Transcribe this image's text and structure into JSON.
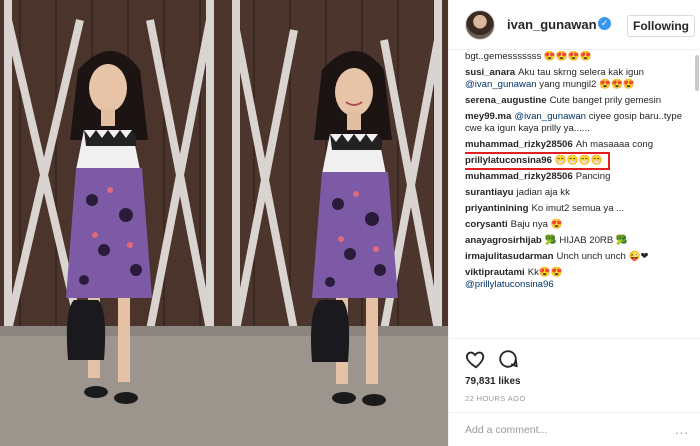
{
  "header": {
    "username": "ivan_gunawan",
    "verified_icon": "verified-badge-icon",
    "follow_label": "Following"
  },
  "comments": [
    {
      "user": "",
      "text": "bgt..gemesssssss 😍😍😍😍"
    },
    {
      "user": "susi_anara",
      "text": "Aku tau skrng selera kak igun",
      "mention": "@ivan_gunawan",
      "after": " yang mungil2 😍😍😍"
    },
    {
      "user": "serena_augustine",
      "text": "Cute banget prily gemesin"
    },
    {
      "user": "mey99.ma",
      "mention": "@ivan_gunawan",
      "after": " ciyee gosip baru..type cwe ka igun kaya prilly ya......"
    },
    {
      "user": "muhammad_rizky28506",
      "text": "Ah masaaaa cong"
    },
    {
      "user": "prillylatuconsina96",
      "text": "😁😁😁😁",
      "highlighted": true
    },
    {
      "user": "muhammad_rizky28506",
      "text": "Pancing"
    },
    {
      "user": "surantiayu",
      "text": "jadian aja kk"
    },
    {
      "user": "priyantinining",
      "text": "Ko imut2 semua ya ..."
    },
    {
      "user": "corysanti",
      "text": "Baju nya 😍"
    },
    {
      "user": "anayagrosirhijab",
      "text": "🥦 HIJAB 20RB 🥦"
    },
    {
      "user": "irmajulitasudarman",
      "text": "Unch unch unch 😜❤"
    },
    {
      "user": "viktiprautami",
      "text": "Kk😍😍"
    },
    {
      "user": "",
      "mention": "@prillylatuconsina96"
    }
  ],
  "actions": {
    "like_icon": "heart-icon",
    "comment_icon": "comment-bubble-icon",
    "likes": "79,831 likes",
    "time": "22 HOURS AGO"
  },
  "add_comment": {
    "placeholder": "Add a comment...",
    "more_label": "..."
  },
  "colors": {
    "accent_blue": "#3897f0",
    "mention": "#003569",
    "highlight_box": "#e02020",
    "wood_wall": "#4a342c",
    "dress_purple": "#7c5aa6"
  }
}
